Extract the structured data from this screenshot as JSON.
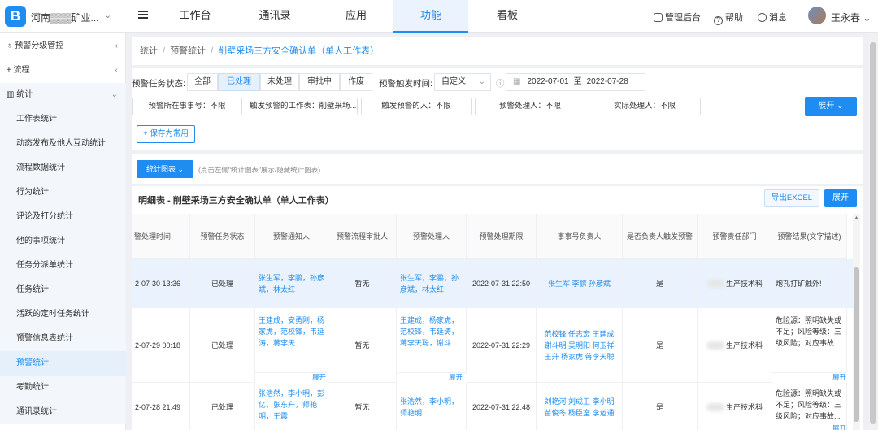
{
  "app": {
    "org_name": "河南▒▒▒矿业...",
    "user": "王永春"
  },
  "nav": {
    "tabs": [
      "工作台",
      "通讯录",
      "应用",
      "功能",
      "看板"
    ],
    "active": "功能"
  },
  "top_links": [
    "管理后台",
    "帮助",
    "消息"
  ],
  "sidebar": {
    "groups": [
      {
        "label": "预警分级管控",
        "chev": "‹"
      },
      {
        "label": "流程",
        "chev": "‹"
      },
      {
        "label": "统计",
        "chev": "⌄"
      }
    ],
    "items": [
      "工作表统计",
      "动态发布及他人互动统计",
      "流程数据统计",
      "行为统计",
      "评论及打分统计",
      "他的事项统计",
      "任务分派单统计",
      "任务统计",
      "活跃的定时任务统计",
      "预警信息表统计",
      "预警统计",
      "考勤统计",
      "通讯录统计"
    ],
    "active": "预警统计"
  },
  "breadcrumb": [
    "统计",
    "预警统计",
    "削壁采场三方安全确认单（单人工作表）"
  ],
  "filters": {
    "status_label": "预警任务状态:",
    "status_options": [
      "全部",
      "已处理",
      "未处理",
      "审批中",
      "作废"
    ],
    "status_active": "已处理",
    "time_label": "预警触发时间:",
    "time_mode": "自定义",
    "date_from": "2022-07-01",
    "date_sep": "至",
    "date_to": "2022-07-28",
    "chips": [
      "预警所在事事号：不限",
      "触发预警的工作表：削壁采场...",
      "触发预警的人：不限",
      "预警处理人：不限",
      "实际处理人：不限"
    ],
    "expand_btn": "展开",
    "save_btn": "保存为常用"
  },
  "chart_toggle": {
    "button": "统计图表",
    "hint": "(点击左侧\"统计图表\"展示/隐藏统计图表)"
  },
  "detail": {
    "title": "明细表 - 削壁采场三方安全确认单（单人工作表）",
    "export": "导出EXCEL",
    "expand": "展开"
  },
  "table": {
    "headers": [
      "警处理时间",
      "预警任务状态",
      "预警通知人",
      "预警流程审批人",
      "预警处理人",
      "预警处理期限",
      "事事号负责人",
      "是否负责人触发预警",
      "预警责任部门",
      "预警结果(文字描述)"
    ],
    "rows": [
      {
        "time": "2-07-30 13:36",
        "status": "已处理",
        "notify": "张生军，李鹏，孙彦斌，林太红",
        "approver": "暂无",
        "handler": "张生军，李鹏，孙彦斌，林太红",
        "deadline": "2022-07-31 22:50",
        "owner": "张生军 李鹏 孙彦斌",
        "trigger": "是",
        "dept": "生产技术科",
        "result": "炮孔打矿触外!",
        "notify_more": "",
        "handler_more": "",
        "result_more": ""
      },
      {
        "time": "2-07-29 00:18",
        "status": "已处理",
        "notify": "王建成，安勇刚，杨家虎，范校锋，韦延涛，蒋李天...",
        "approver": "暂无",
        "handler": "王建成，杨家虎，范校锋，韦延涛，蒋李天聪，谢斗...",
        "deadline": "2022-07-31 22:29",
        "owner": "范校锋 任志宏 王建成 谢斗明 吴明阳 何玉祥 王升 杨家虎 蒋李天聪",
        "trigger": "是",
        "dept": "生产技术科",
        "result": "危险源：照明缺失或不足；风险等级：三级风险；对应事故...",
        "notify_more": "展开",
        "handler_more": "展开",
        "result_more": "展开"
      },
      {
        "time": "2-07-28 21:49",
        "status": "已处理",
        "notify": "张浩然，李小明，彭亿，张东升，师艳明，王震",
        "approver": "暂无",
        "handler": "张浩然，李小明，师艳明",
        "deadline": "2022-07-31 22:48",
        "owner": "刘艳河 刘成卫 李小明 苗俊冬 杨臣室 李运通",
        "trigger": "是",
        "dept": "生产技术科",
        "result": "危险源：照明缺失或不足；风险等级：三级风险；对应事故...",
        "notify_more": "",
        "handler_more": "",
        "result_more": "展开"
      }
    ]
  }
}
